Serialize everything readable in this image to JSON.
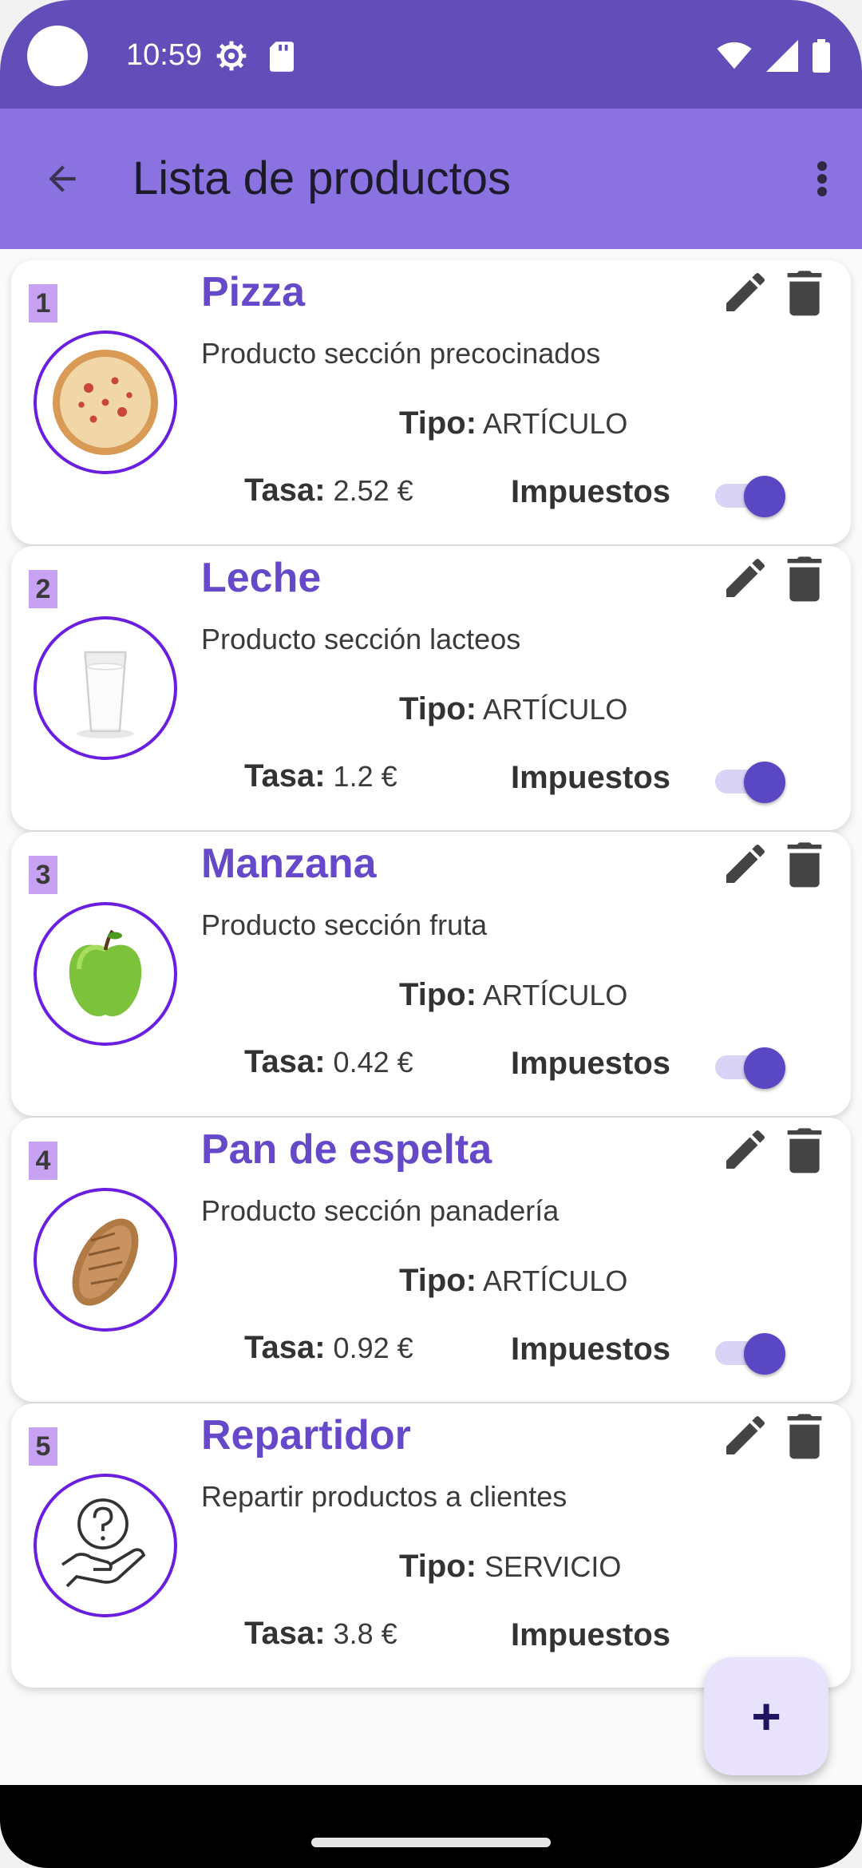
{
  "status_bar": {
    "time": "10:59"
  },
  "app_bar": {
    "title": "Lista de productos"
  },
  "labels": {
    "type": "Tipo:",
    "rate": "Tasa:",
    "tax": "Impuestos"
  },
  "products": [
    {
      "index": "1",
      "name": "Pizza",
      "description": "Producto sección precocinados",
      "type": "ARTÍCULO",
      "rate": "2.52 €",
      "tax_on": true,
      "image": "pizza-image"
    },
    {
      "index": "2",
      "name": "Leche",
      "description": "Producto sección lacteos",
      "type": "ARTÍCULO",
      "rate": "1.2 €",
      "tax_on": true,
      "image": "milk-glass-image"
    },
    {
      "index": "3",
      "name": "Manzana",
      "description": "Producto sección fruta",
      "type": "ARTÍCULO",
      "rate": "0.42 €",
      "tax_on": true,
      "image": "apple-image"
    },
    {
      "index": "4",
      "name": "Pan de espelta",
      "description": "Producto sección panadería",
      "type": "ARTÍCULO",
      "rate": "0.92 €",
      "tax_on": true,
      "image": "bread-image"
    },
    {
      "index": "5",
      "name": "Repartidor",
      "description": "Repartir productos a clientes",
      "type": "SERVICIO",
      "rate": "3.8 €",
      "tax_on": true,
      "image": "service-hand-icon"
    }
  ],
  "fab": {
    "label": "+"
  },
  "colors": {
    "status_bar": "#634eb9",
    "app_bar": "#8a72e0",
    "accent": "#6549c8",
    "avatar_border": "#6a1ee0",
    "index_badge": "#c7a2f2"
  }
}
